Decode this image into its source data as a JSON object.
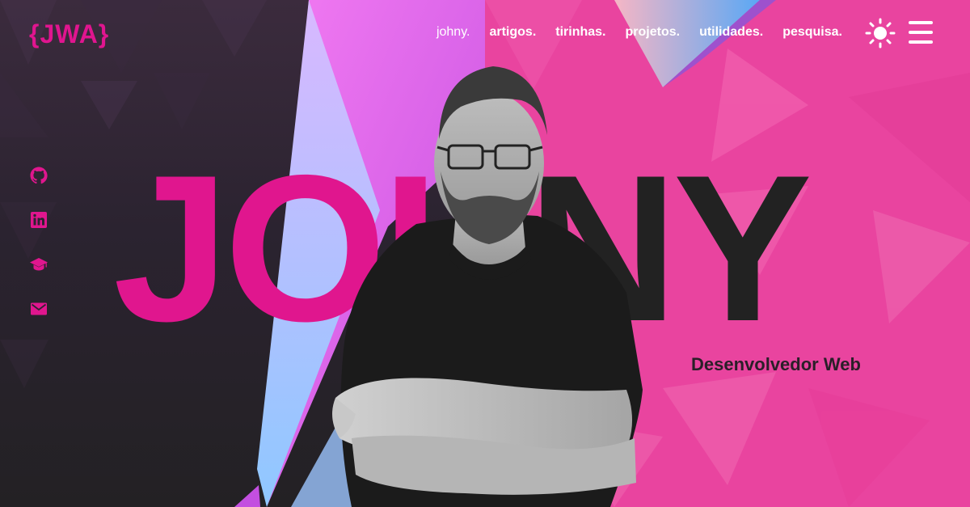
{
  "brand": {
    "logo": "{JWA}"
  },
  "nav": {
    "items": [
      {
        "label": "johny.",
        "current": true
      },
      {
        "label": "artigos."
      },
      {
        "label": "tirinhas."
      },
      {
        "label": "projetos."
      },
      {
        "label": "utilidades."
      },
      {
        "label": "pesquisa."
      }
    ]
  },
  "controls": {
    "theme_icon": "sun-icon",
    "menu_icon": "hamburger-icon"
  },
  "social": [
    "github-icon",
    "linkedin-icon",
    "graduation-cap-icon",
    "email-icon"
  ],
  "hero": {
    "name_part1": "JOH",
    "name_part2": "NY",
    "role": "Desenvolvedor Web"
  },
  "colors": {
    "accent": "#e0168e",
    "pink_bg": "#e9449f",
    "dark_bg": "#2b2330",
    "text_dark": "#222222"
  }
}
